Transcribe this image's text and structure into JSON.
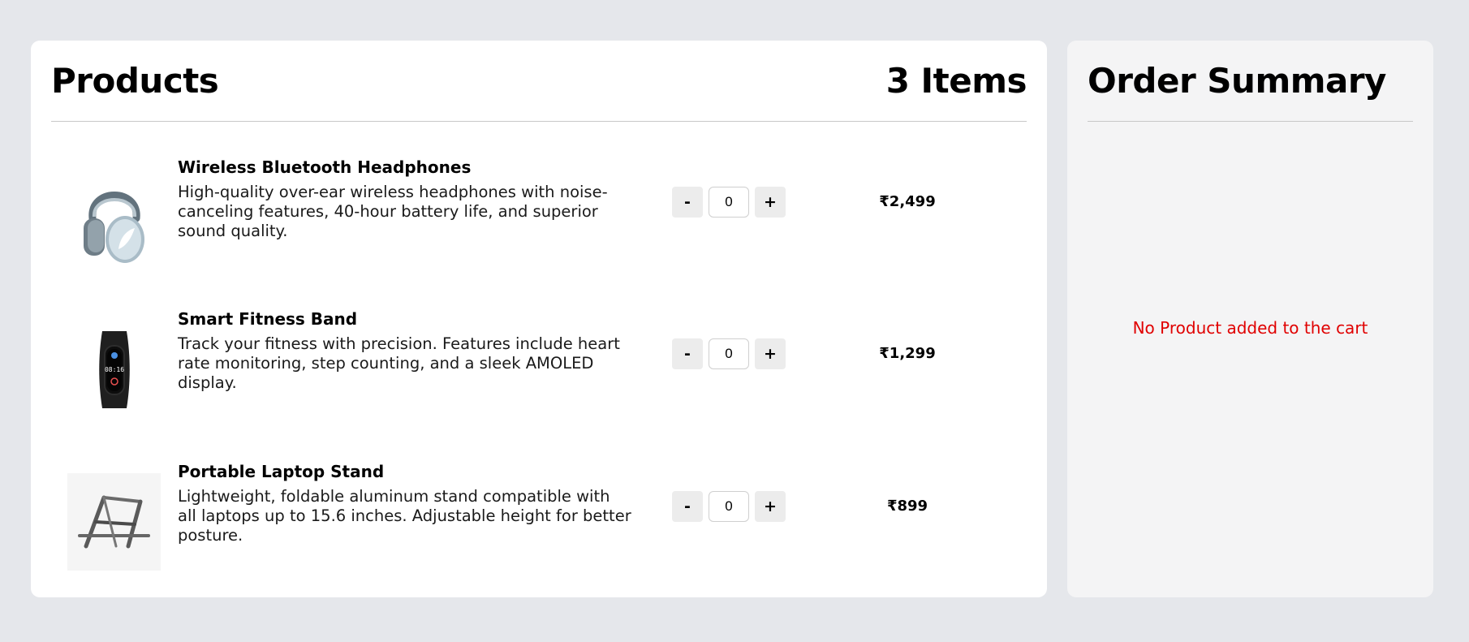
{
  "products_panel": {
    "title": "Products",
    "item_count": "3 Items"
  },
  "products": [
    {
      "name": "Wireless Bluetooth Headphones",
      "description": "High-quality over-ear wireless headphones with noise-canceling features, 40-hour battery life, and superior sound quality.",
      "quantity": "0",
      "price": "₹2,499",
      "image_icon": "headphones-image"
    },
    {
      "name": "Smart Fitness Band",
      "description": "Track your fitness with precision. Features include heart rate monitoring, step counting, and a sleek AMOLED display.",
      "quantity": "0",
      "price": "₹1,299",
      "image_icon": "fitness-band-image",
      "band_screen_time": "08:16"
    },
    {
      "name": "Portable Laptop Stand",
      "description": "Lightweight, foldable aluminum stand compatible with all laptops up to 15.6 inches. Adjustable height for better posture.",
      "quantity": "0",
      "price": "₹899",
      "image_icon": "laptop-stand-image"
    }
  ],
  "controls": {
    "decrement_label": "-",
    "increment_label": "+"
  },
  "summary": {
    "title": "Order Summary",
    "empty_message": "No Product added to the cart"
  },
  "colors": {
    "page_background": "#e5e7eb",
    "card_background": "#ffffff",
    "summary_background": "#f4f4f5",
    "empty_message": "#e00000"
  }
}
